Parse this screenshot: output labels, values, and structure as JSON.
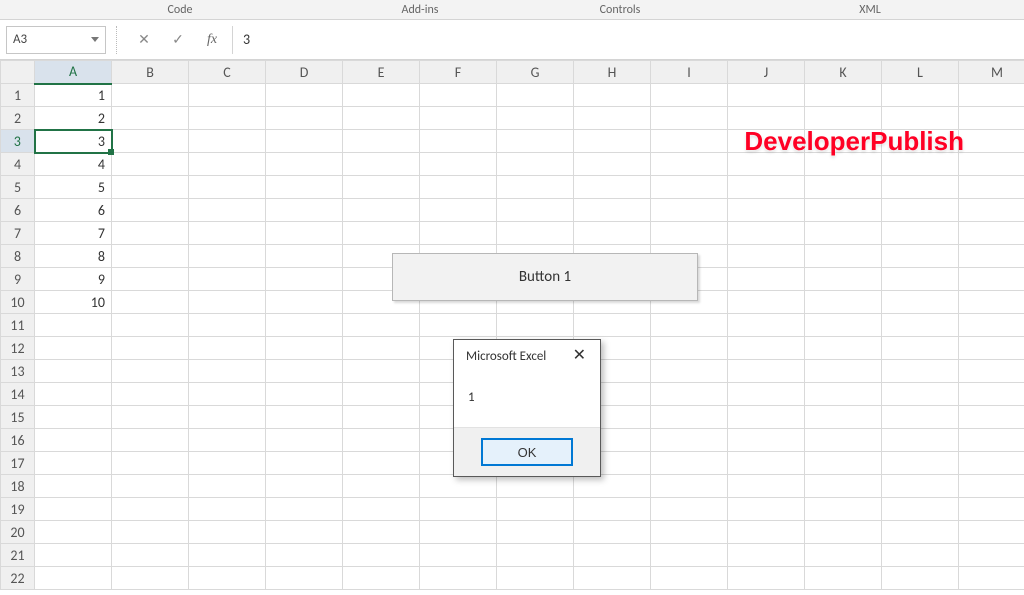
{
  "ribbon": {
    "groups": [
      "Code",
      "Add-ins",
      "Controls",
      "XML"
    ]
  },
  "name_box": "A3",
  "formula_value": "3",
  "columns": [
    "A",
    "B",
    "C",
    "D",
    "E",
    "F",
    "G",
    "H",
    "I",
    "J",
    "K",
    "L",
    "M"
  ],
  "row_count": 22,
  "selected": {
    "col": "A",
    "row": 3
  },
  "cell_data": {
    "A1": "1",
    "A2": "2",
    "A3": "3",
    "A4": "4",
    "A5": "5",
    "A6": "6",
    "A7": "7",
    "A8": "8",
    "A9": "9",
    "A10": "10"
  },
  "watermark": "DeveloperPublish",
  "form_button": {
    "label": "Button 1"
  },
  "msgbox": {
    "title": "Microsoft Excel",
    "body": "1",
    "ok_label": "OK"
  }
}
